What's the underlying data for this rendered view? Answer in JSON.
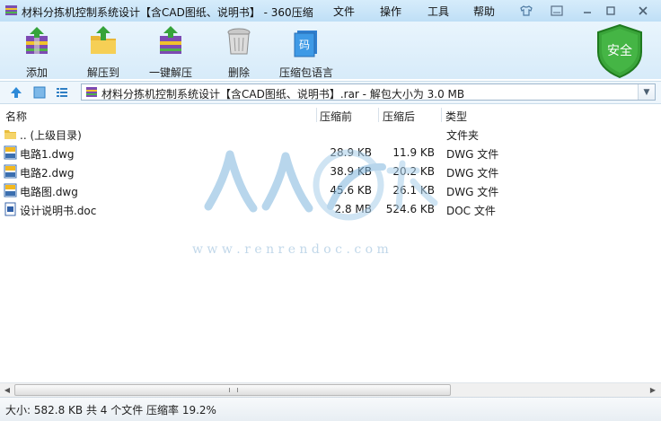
{
  "window": {
    "title": "材料分拣机控制系统设计【含CAD图纸、说明书】 - 360压缩",
    "menus": [
      "文件",
      "操作",
      "工具",
      "帮助"
    ]
  },
  "toolbar": {
    "buttons": [
      {
        "label": "添加",
        "icon": "add-archive-icon"
      },
      {
        "label": "解压到",
        "icon": "extract-to-icon"
      },
      {
        "label": "一键解压",
        "icon": "one-click-extract-icon"
      },
      {
        "label": "删除",
        "icon": "trash-icon"
      },
      {
        "label": "压缩包语言",
        "icon": "archive-language-icon"
      }
    ],
    "safe_badge": "安全",
    "language_badge": "码"
  },
  "address": {
    "path": "材料分拣机控制系统设计【含CAD图纸、说明书】.rar - 解包大小为 3.0 MB"
  },
  "columns": {
    "name": "名称",
    "packed": "压缩前",
    "compressed": "压缩后",
    "type": "类型"
  },
  "files": [
    {
      "name": ".. (上级目录)",
      "packed": "",
      "compressed": "",
      "type": "文件夹",
      "icon": "folder-icon"
    },
    {
      "name": "电路1.dwg",
      "packed": "28.9 KB",
      "compressed": "11.9 KB",
      "type": "DWG 文件",
      "icon": "dwg-file-icon"
    },
    {
      "name": "电路2.dwg",
      "packed": "38.9 KB",
      "compressed": "20.2 KB",
      "type": "DWG 文件",
      "icon": "dwg-file-icon"
    },
    {
      "name": "电路图.dwg",
      "packed": "45.6 KB",
      "compressed": "26.1 KB",
      "type": "DWG 文件",
      "icon": "dwg-file-icon"
    },
    {
      "name": "设计说明书.doc",
      "packed": "2.8 MB",
      "compressed": "524.6 KB",
      "type": "DOC 文件",
      "icon": "doc-file-icon"
    }
  ],
  "watermark": {
    "url": "w w w . r e n r e n d o c . c o m"
  },
  "status": {
    "text": "大小: 582.8 KB 共 4 个文件 压缩率 19.2%"
  },
  "colors": {
    "accent": "#3d8fd8",
    "safe_green": "#2f9a2f",
    "titlebar": "#cbe5f8"
  }
}
